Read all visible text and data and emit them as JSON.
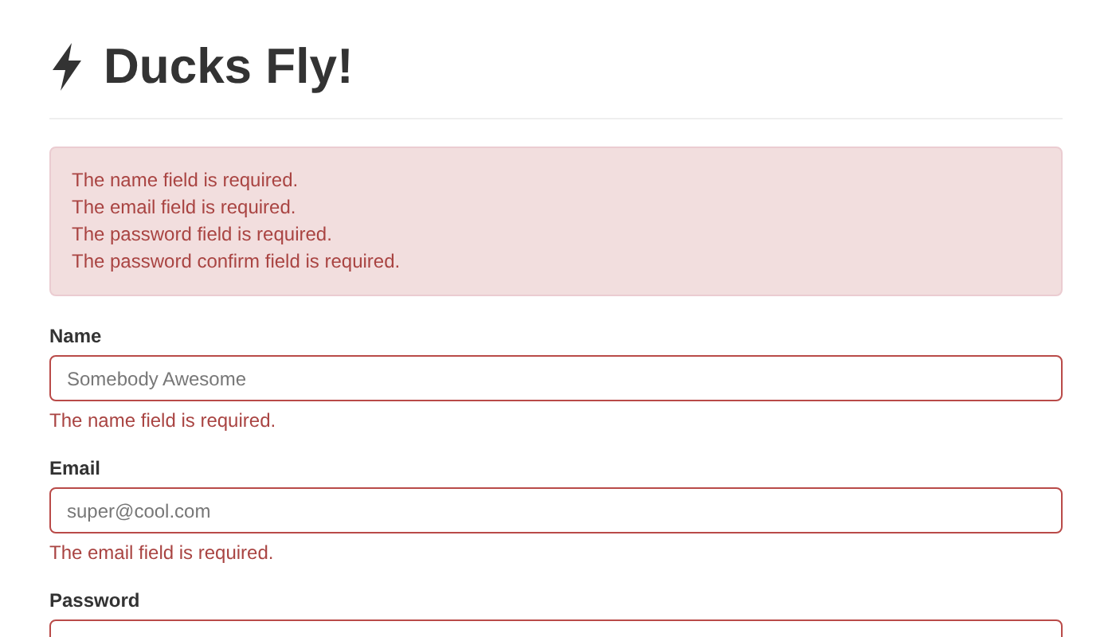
{
  "title": "Ducks Fly!",
  "alert": {
    "messages": [
      "The name field is required.",
      "The email field is required.",
      "The password field is required.",
      "The password confirm field is required."
    ]
  },
  "fields": [
    {
      "label": "Name",
      "placeholder": "Somebody Awesome",
      "invalid": true,
      "error": "The name field is required."
    },
    {
      "label": "Email",
      "placeholder": "super@cool.com",
      "invalid": true,
      "error": "The email field is required."
    },
    {
      "label": "Password",
      "invalid": true
    }
  ]
}
